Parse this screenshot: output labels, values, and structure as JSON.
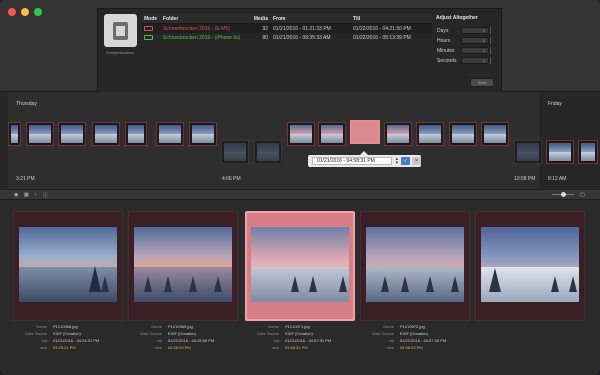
{
  "media_panel": {
    "caption": "Schneebrocken"
  },
  "media_table": {
    "headers": {
      "mode": "Mode",
      "folder": "Folder",
      "media": "Media",
      "from": "From",
      "till": "Till"
    },
    "rows": [
      {
        "folder": "Schneebrocken 2016 - (E-M5)",
        "media": "92",
        "from": "01/21/2016 - 01:21:33 PM",
        "till": "01/22/2016 - 04:21:50 PM",
        "color": "#d8505a"
      },
      {
        "folder": "Schneebrocken 2016 - (iPhone 6s)",
        "media": "80",
        "from": "01/21/2016 - 08:35:33 AM",
        "till": "01/22/2016 - 05:13:39 PM",
        "color": "#4fbf5a"
      }
    ]
  },
  "adjust": {
    "title": "Adjust Altogether",
    "fields": [
      {
        "label": "Days",
        "value": "0"
      },
      {
        "label": "Hours",
        "value": "0"
      },
      {
        "label": "Minutes",
        "value": "0"
      },
      {
        "label": "Seconds",
        "value": "0"
      }
    ],
    "save_label": "Save"
  },
  "timeline": {
    "day_left": "Thursday",
    "day_right": "Friday",
    "ticks": [
      "3:21 PM",
      "4:06 PM",
      "10:08 PM",
      "8:12 AM"
    ],
    "popover_value": "01/21/2016 - 04:58:31 PM"
  },
  "toolbar": {
    "icons": [
      "eye-icon",
      "grid-icon",
      "pin-icon",
      "info-icon"
    ]
  },
  "photos": [
    {
      "name": "P1210068.jpg",
      "source": "EXIF (Creation)",
      "old": "01/21/2016 - 04:24:21 PM",
      "new": "04:25:21 PM"
    },
    {
      "name": "P1210069.jpg",
      "source": "EXIF (Creation)",
      "old": "01/21/2016 - 04:25:59 PM",
      "new": "04:26:59 PM"
    },
    {
      "name": "P1210071.jpg",
      "source": "EXIF (Creation)",
      "old": "01/21/2016 - 04:57:31 PM",
      "new": "04:58:31 PM"
    },
    {
      "name": "P1210072.jpg",
      "source": "EXIF (Creation)",
      "old": "01/21/2016 - 04:57:33 PM",
      "new": "04:58:33 PM"
    },
    {
      "name": "",
      "source": "",
      "old": "",
      "new": ""
    }
  ],
  "meta_labels": {
    "name": "Name",
    "source": "Data Source",
    "old": "old",
    "new": "new"
  }
}
